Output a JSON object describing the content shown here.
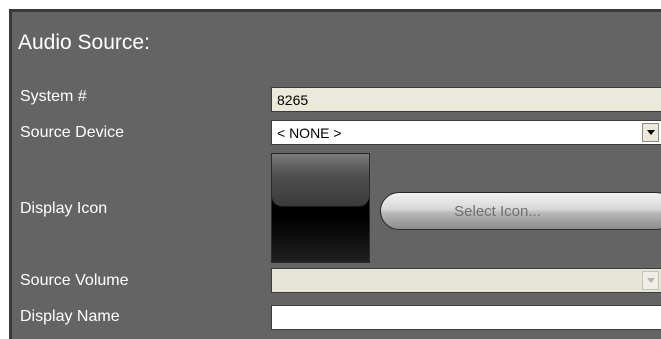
{
  "section": {
    "title": "Audio Source:"
  },
  "fields": {
    "system_number": {
      "label": "System #",
      "value": "8265"
    },
    "source_device": {
      "label": "Source Device",
      "value": "< NONE >"
    },
    "display_icon": {
      "label": "Display Icon",
      "button_label": "Select Icon..."
    },
    "source_volume": {
      "label": "Source Volume",
      "value": ""
    },
    "display_name": {
      "label": "Display Name",
      "value": ""
    }
  },
  "icons": {
    "dropdown": "chevron-down-icon"
  },
  "colors": {
    "panel_bg": "#646464",
    "label_text": "#ffffff",
    "readonly_field_bg": "#ebe9da"
  }
}
